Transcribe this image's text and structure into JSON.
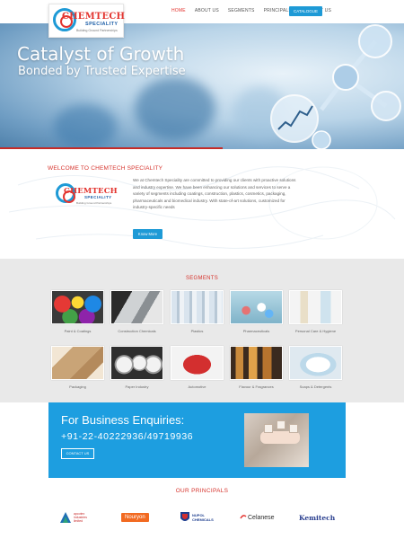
{
  "header": {
    "logo_text": "CHEMTECH",
    "logo_sub": "SPECIALITY",
    "logo_tag": "Building Ground Partnerships",
    "nav": [
      "HOME",
      "ABOUT US",
      "SEGMENTS",
      "PRINCIPALS",
      "CONTACT US"
    ],
    "active_nav": "HOME",
    "catalogue_label": "CATALOGUE"
  },
  "hero": {
    "title": "Catalyst of Growth",
    "subtitle": "Bonded by Trusted Expertise"
  },
  "welcome": {
    "title": "WELCOME TO CHEMTECH SPECIALITY",
    "text": "We at Chemtech Speciality are committed to providing our clients with proactive solutions and industry expertise. We have been enhancing our solutions and services to serve a variety of segments including coatings, construction, plastics, cosmetics, packaging, pharmaceuticals and biomedical industry. With state-of-art solutions, customized for industry-specific needs",
    "button": "Know More"
  },
  "segments": {
    "title": "SEGMENTS",
    "items": [
      {
        "label": "Paint & Coatings"
      },
      {
        "label": "Construction Chemicals"
      },
      {
        "label": "Plastics"
      },
      {
        "label": "Pharmaceuticals"
      },
      {
        "label": "Personal Care & Hygiene"
      },
      {
        "label": "Packaging"
      },
      {
        "label": "Paper Industry"
      },
      {
        "label": "Automotive"
      },
      {
        "label": "Flavour & Fragrances"
      },
      {
        "label": "Soaps & Detergents"
      }
    ]
  },
  "enquiry": {
    "title": "For Business Enquiries:",
    "phone": "+91-22-40222936/49719936",
    "button": "CONTACT US"
  },
  "principals": {
    "title": "OUR PRINCIPALS",
    "logos": [
      {
        "name": "apcotex industries limited"
      },
      {
        "name": "Nouryon"
      },
      {
        "name": "NUPOL CHEMICALS"
      },
      {
        "name": "Celanese"
      },
      {
        "name": "Kemitech"
      }
    ]
  },
  "colors": {
    "accent_blue": "#1e9ad6",
    "accent_red": "#d6332c",
    "segment_bg": "#e9e9e9"
  }
}
